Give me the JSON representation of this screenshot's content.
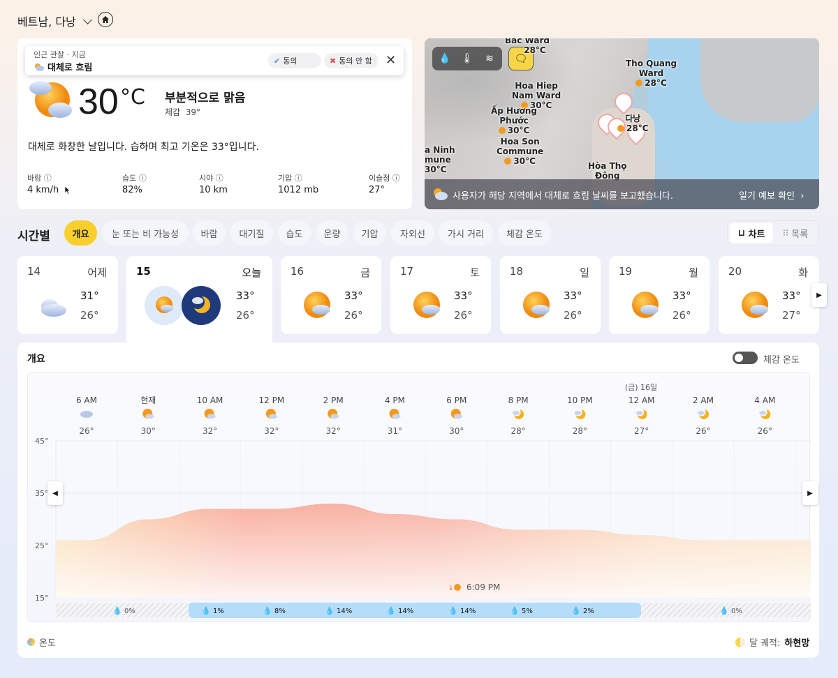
{
  "header": {
    "location": "베트남, 다낭"
  },
  "observation": {
    "subtitle": "인근 관찰 · 지금",
    "condition": "대체로 흐림",
    "agree": "동의",
    "disagree": "동의 안 함"
  },
  "current": {
    "temp": "30",
    "unit": "°C",
    "condition": "부분적으로 맑음",
    "feels_label": "체감",
    "feels_value": "39°",
    "description": "대체로 화창한 날입니다. 습하며 최고 기온은 33°입니다.",
    "stats": [
      {
        "label": "바람",
        "value": "4 km/h"
      },
      {
        "label": "습도",
        "value": "82%"
      },
      {
        "label": "시야",
        "value": "10 km"
      },
      {
        "label": "기압",
        "value": "1012 mb"
      },
      {
        "label": "이슬점",
        "value": "27°"
      }
    ]
  },
  "map": {
    "labels": [
      {
        "name": "Bac Ward",
        "temp": "28°C"
      },
      {
        "name": "Tho Quang\nWard",
        "temp": "28°C"
      },
      {
        "name": "Hoa Hiep\nNam Ward",
        "temp": "30°C"
      },
      {
        "name": "Ấp Hương\nPhước",
        "temp": "30°C"
      },
      {
        "name": "Hoa Son\nCommune",
        "temp": "30°C"
      },
      {
        "name": "a Ninh\nmune",
        "temp": "30°C"
      },
      {
        "name": "다낭",
        "temp": "28°C"
      },
      {
        "name": "Hòa Thọ\nĐông",
        "temp": ""
      }
    ],
    "banner_text": "사용자가 해당 지역에서 대체로 흐림 날씨를 보고했습니다.",
    "banner_link": "일기 예보 확인"
  },
  "hourly": {
    "title": "시간별",
    "chips": [
      "개요",
      "눈 또는 비 가능성",
      "바람",
      "대기질",
      "습도",
      "운량",
      "기압",
      "자외선",
      "가시 거리",
      "체감 온도"
    ],
    "view_chart": "차트",
    "view_list": "목록"
  },
  "days": [
    {
      "num": "14",
      "name": "어제",
      "hi": "31°",
      "lo": "26°",
      "icon": "cloudy"
    },
    {
      "num": "15",
      "name": "오늘",
      "hi": "33°",
      "lo": "26°",
      "icon": "partly-sunny"
    },
    {
      "num": "16",
      "name": "금",
      "hi": "33°",
      "lo": "26°",
      "icon": "partly-sunny"
    },
    {
      "num": "17",
      "name": "토",
      "hi": "33°",
      "lo": "26°",
      "icon": "partly-sunny"
    },
    {
      "num": "18",
      "name": "일",
      "hi": "33°",
      "lo": "26°",
      "icon": "partly-sunny"
    },
    {
      "num": "19",
      "name": "월",
      "hi": "33°",
      "lo": "26°",
      "icon": "partly-sunny"
    },
    {
      "num": "20",
      "name": "화",
      "hi": "33°",
      "lo": "27°",
      "icon": "partly-sunny"
    }
  ],
  "panel": {
    "title": "개요",
    "feels_toggle": "체감 온도",
    "legend_temp": "온도",
    "moon_label": "달 궤적:",
    "moon_value": "하현망"
  },
  "chart_data": {
    "type": "area",
    "date_marker": "(금) 16일",
    "sunset_label": "6:09 PM",
    "y_ticks": [
      "45°",
      "35°",
      "25°",
      "15°"
    ],
    "ylim": [
      15,
      45
    ],
    "hours": [
      "6 AM",
      "현재",
      "10 AM",
      "12 PM",
      "2 PM",
      "4 PM",
      "6 PM",
      "8 PM",
      "10 PM",
      "12 AM",
      "2 AM",
      "4 AM"
    ],
    "hour_temps": [
      "26°",
      "30°",
      "32°",
      "32°",
      "32°",
      "31°",
      "30°",
      "28°",
      "28°",
      "27°",
      "26°",
      "26°"
    ],
    "hour_icons": [
      "cloudy",
      "partly-sunny",
      "partly-sunny",
      "partly-sunny",
      "partly-sunny",
      "partly-sunny",
      "partly-sunny",
      "moon-cloud",
      "moon-cloud",
      "moon-cloud",
      "moon-cloud",
      "moon-cloud"
    ],
    "series": [
      {
        "values": [
          26,
          30,
          32,
          32,
          33,
          31,
          30,
          28,
          28,
          27,
          26,
          26
        ]
      }
    ],
    "precip": [
      "0%",
      "1%",
      "8%",
      "14%",
      "14%",
      "14%",
      "5%",
      "2%",
      "0%"
    ]
  }
}
